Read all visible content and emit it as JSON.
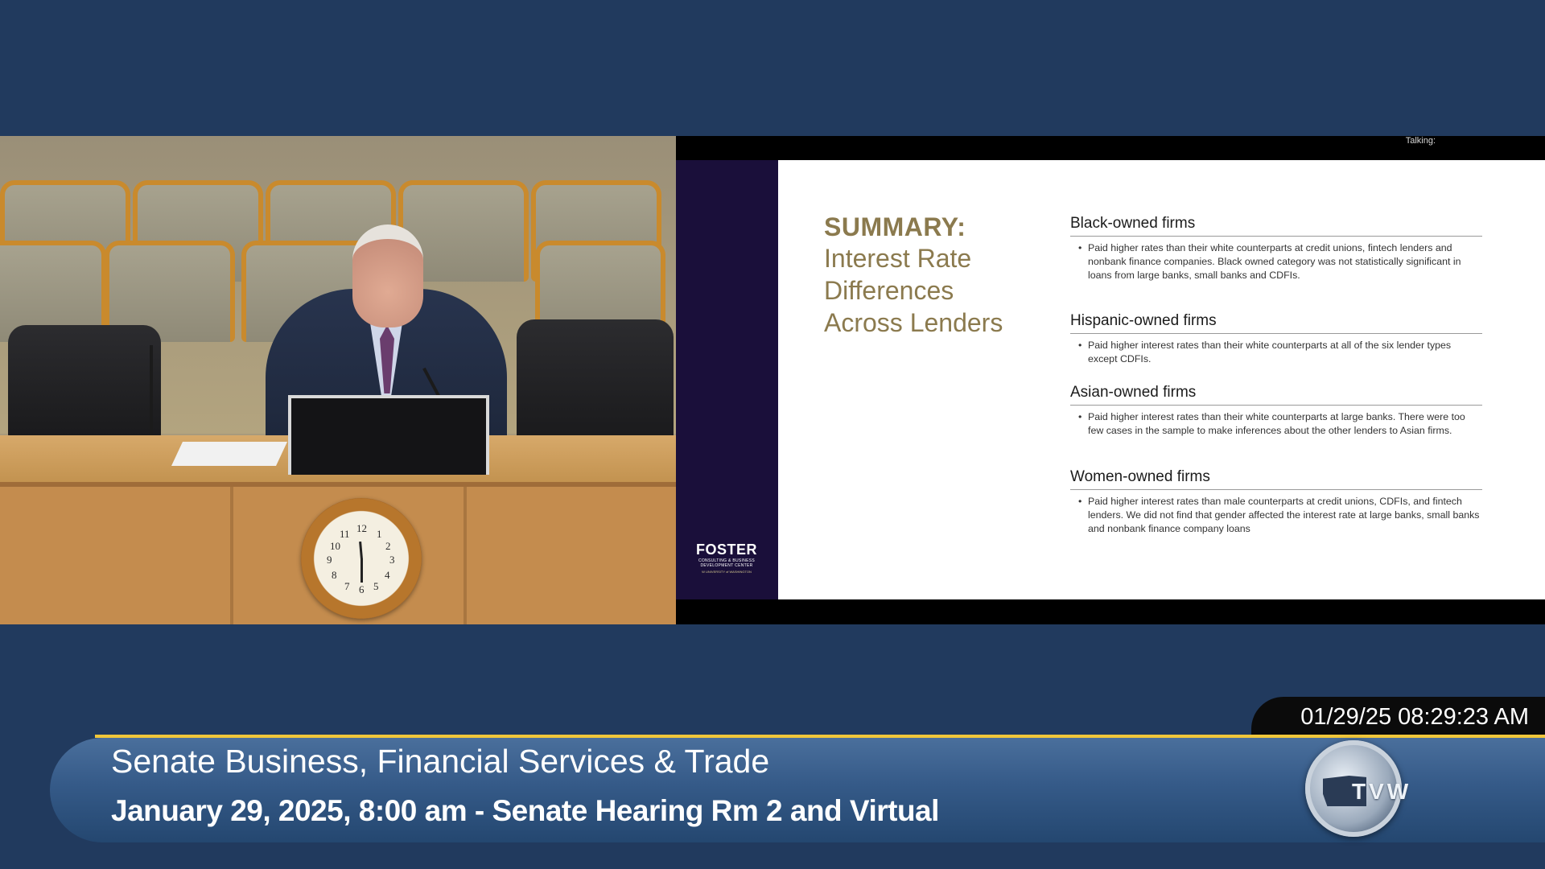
{
  "slide": {
    "talking_label": "Talking:",
    "title_bold": "SUMMARY:",
    "title_line1": "Interest Rate",
    "title_line2": "Differences",
    "title_line3": "Across Lenders",
    "logo_word": "FOSTER",
    "logo_sub1": "CONSULTING & BUSINESS",
    "logo_sub2": "DEVELOPMENT CENTER",
    "logo_uw": "W UNIVERSITY of WASHINGTON",
    "sections": [
      {
        "heading": "Black-owned firms",
        "text": "Paid higher rates than their white counterparts at credit unions, fintech lenders and nonbank finance companies. Black owned category was not statistically significant in loans from large banks, small banks and CDFIs."
      },
      {
        "heading": "Hispanic-owned firms",
        "text": "Paid higher interest rates than their white counterparts at all of the six lender types except CDFIs."
      },
      {
        "heading": "Asian-owned firms",
        "text": "Paid higher interest rates than their white counterparts at large banks. There were too few cases in the sample to make inferences about the other lenders to Asian firms."
      },
      {
        "heading": "Women-owned firms",
        "text": "Paid higher interest rates than male counterparts at credit unions, CDFIs, and fintech lenders. We did not find that gender affected the interest rate at large banks, small banks and nonbank finance company loans"
      }
    ]
  },
  "clock": {
    "numerals": [
      "12",
      "1",
      "2",
      "3",
      "4",
      "5",
      "6",
      "7",
      "8",
      "9",
      "10",
      "11"
    ]
  },
  "lower_third": {
    "datetime": "01/29/25 08:29:23 AM",
    "title": "Senate Business, Financial Services & Trade",
    "subtitle": "January 29, 2025, 8:00 am - Senate Hearing Rm 2 and Virtual",
    "logo_text": "TVW"
  },
  "colors": {
    "background": "#213a5e",
    "accent_gold": "#f0c63a",
    "slide_title": "#8b7a4e",
    "slide_sidebar": "#1a0f3a"
  }
}
